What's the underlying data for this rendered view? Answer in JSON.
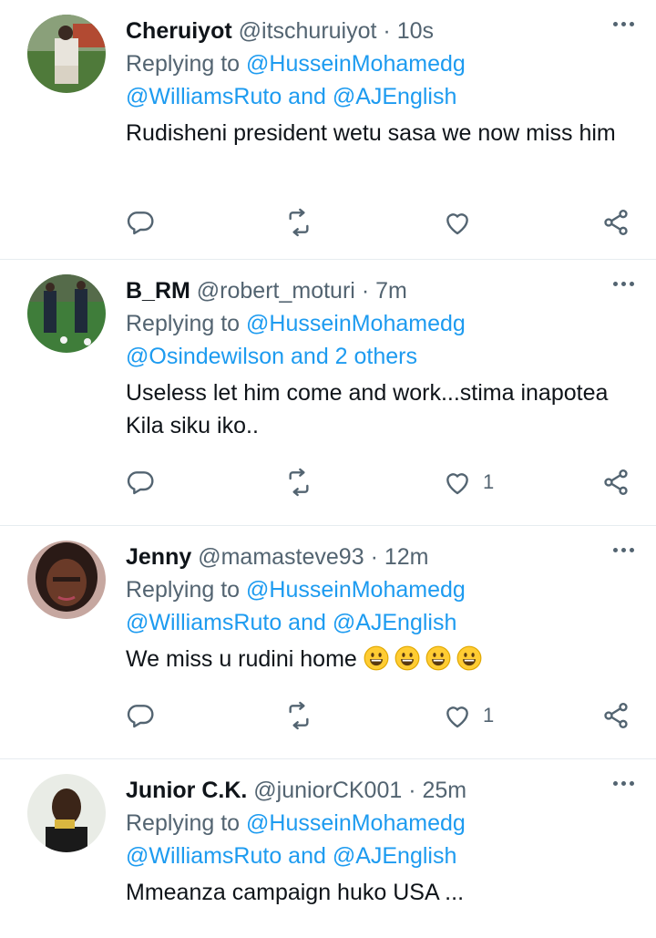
{
  "tweets": [
    {
      "name": "Cheruiyot",
      "handle": "@itschuruiyot",
      "dot": "·",
      "time": "10s",
      "replying_prefix": "Replying to",
      "reply_to_1": "@HusseinMohamedg",
      "reply_to_2": "@WilliamsRuto and @AJEnglish",
      "text": "Rudisheni president wetu sasa we now miss him",
      "like_count": ""
    },
    {
      "name": "B_RM",
      "handle": "@robert_moturi",
      "dot": "·",
      "time": "7m",
      "replying_prefix": "Replying to",
      "reply_to_1": "@HusseinMohamedg",
      "reply_to_2": "@Osindewilson and 2 others",
      "text": "Useless let him come and work...stima inapotea Kila siku iko..",
      "like_count": "1"
    },
    {
      "name": "Jenny",
      "handle": "@mamasteve93",
      "dot": "·",
      "time": "12m",
      "replying_prefix": "Replying to",
      "reply_to_1": "@HusseinMohamedg",
      "reply_to_2": "@WilliamsRuto and @AJEnglish",
      "text": "We miss u rudini home",
      "like_count": "1"
    },
    {
      "name": "Junior C.K.",
      "handle": "@juniorCK001",
      "dot": "·",
      "time": "25m",
      "replying_prefix": "Replying to",
      "reply_to_1": "@HusseinMohamedg",
      "reply_to_2": "@WilliamsRuto and @AJEnglish",
      "text": "Mmeanza campaign huko USA ...",
      "like_count": ""
    }
  ],
  "icons": {
    "reply": "reply-icon",
    "retweet": "retweet-icon",
    "like": "heart-icon",
    "share": "share-icon",
    "more": "more-icon",
    "emoji": "grinning-face-emoji"
  },
  "colors": {
    "link": "#1d9bf0",
    "secondary": "#536471",
    "divider": "#e6ecf0"
  }
}
